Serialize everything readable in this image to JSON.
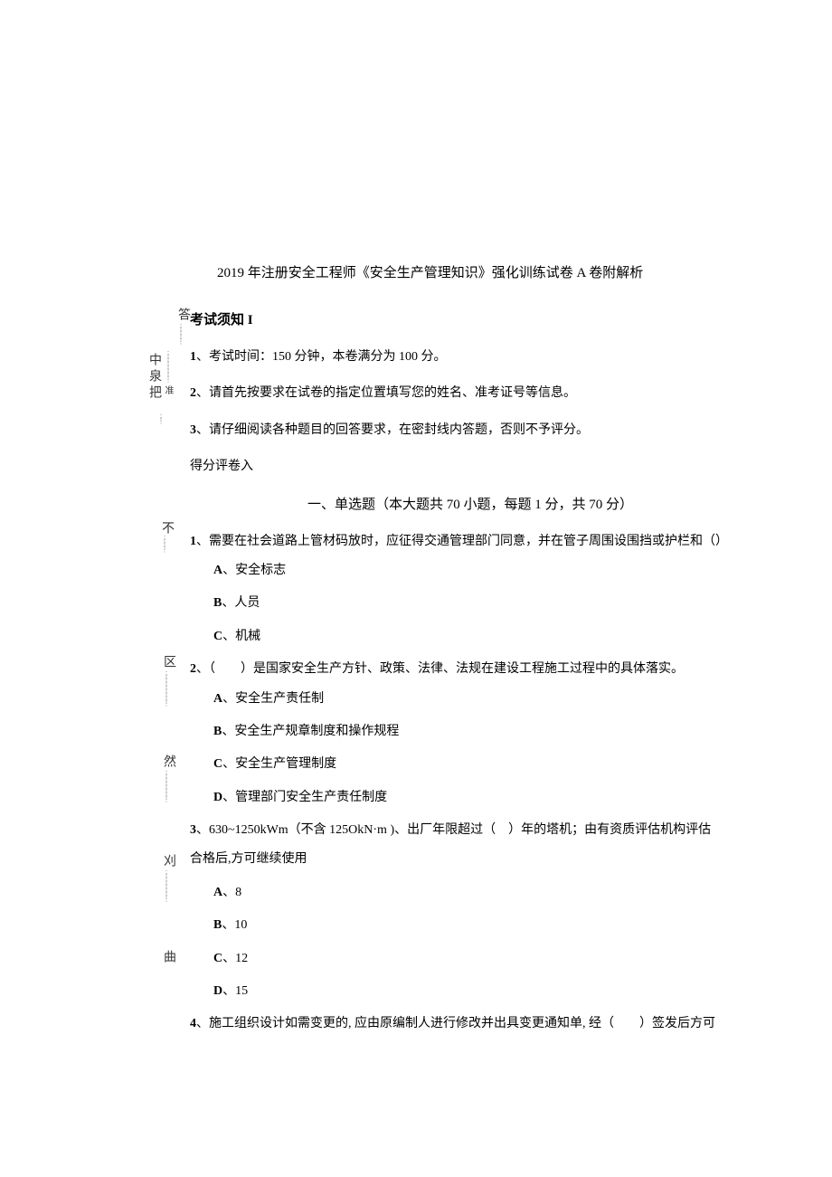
{
  "header": {
    "title": "2019 年注册安全工程师《安全生产管理知识》强化训练试卷 A 卷附解析"
  },
  "notice": {
    "label": "考试须知 I",
    "items": [
      {
        "num": "1",
        "text": "、考试时间：150 分钟，本卷满分为 100 分。"
      },
      {
        "num": "2",
        "text": "、请首先按要求在试卷的指定位置填写您的姓名、准考证号等信息。"
      },
      {
        "num": "3",
        "text": "、请仔细阅读各种题目的回答要求，在密封线内答题，否则不予评分。"
      }
    ],
    "score_entry": "得分评卷入"
  },
  "section1": {
    "title": "一、单选题（本大题共 70 小题，每题 1 分，共 70 分）"
  },
  "questions": [
    {
      "num": "1",
      "text": "、需要在社会道路上管材码放时，应征得交通管理部门同意，并在管子周围设围挡或护栏和（）",
      "options": [
        {
          "letter": "A",
          "text": "、安全标志"
        },
        {
          "letter": "B",
          "text": "、人员"
        },
        {
          "letter": "C",
          "text": "、机械"
        }
      ]
    },
    {
      "num": "2",
      "text": "、（　　）是国家安全生产方针、政策、法律、法规在建设工程施工过程中的具体落实。",
      "options": [
        {
          "letter": "A",
          "text": "、安全生产责任制"
        },
        {
          "letter": "B",
          "text": "、安全生产规章制度和操作规程"
        },
        {
          "letter": "C",
          "text": "、安全生产管理制度"
        },
        {
          "letter": "D",
          "text": "、管理部门安全生产责任制度"
        }
      ]
    },
    {
      "num": "3",
      "text": "、630~1250kWm（不含 125OkN·m )、出厂年限超过（　）年的塔机；由有资质评估机构评估",
      "text_cont": "合格后,方可继续使用",
      "options": [
        {
          "letter": "A",
          "text": "、8"
        },
        {
          "letter": "B",
          "text": "、10"
        },
        {
          "letter": "C",
          "text": "、12"
        },
        {
          "letter": "D",
          "text": "、15"
        }
      ]
    },
    {
      "num": "4",
      "text": "、施工组织设计如需变更的, 应由原编制人进行修改并出具变更通知单, 经（　　）签发后方可"
    }
  ],
  "side": {
    "chars": [
      "答",
      "中",
      "泉",
      "把",
      "准",
      "不",
      "区",
      "然",
      "刈",
      "曲"
    ]
  }
}
